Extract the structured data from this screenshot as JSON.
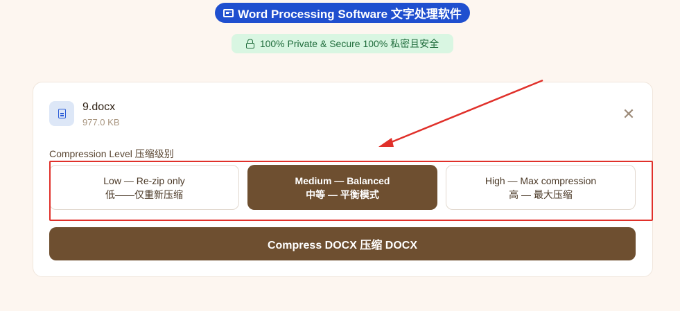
{
  "header": {
    "badge_icon": "document-icon",
    "title": "Word Processing Software 文字处理软件",
    "secure_icon": "lock-icon",
    "secure_text": "100% Private & Secure  100% 私密且安全"
  },
  "file": {
    "icon": "file-icon",
    "name": "9.docx",
    "size": "977.0 KB",
    "close_icon": "close-icon",
    "close_glyph": "✕"
  },
  "compression": {
    "label": "Compression Level 压缩级别",
    "options": [
      {
        "title": "Low — Re-zip only",
        "subtitle": "低——仅重新压缩",
        "selected": false
      },
      {
        "title": "Medium — Balanced",
        "subtitle": "中等 — 平衡模式",
        "selected": true
      },
      {
        "title": "High — Max compression",
        "subtitle": "高 — 最大压缩",
        "selected": false
      }
    ]
  },
  "action": {
    "compress_label": "Compress DOCX 压缩 DOCX"
  },
  "colors": {
    "accent_brown": "#6e4f30",
    "badge_blue": "#1f4fcf",
    "secure_green": "#d9f6e2",
    "annotation_red": "#e0302a"
  }
}
